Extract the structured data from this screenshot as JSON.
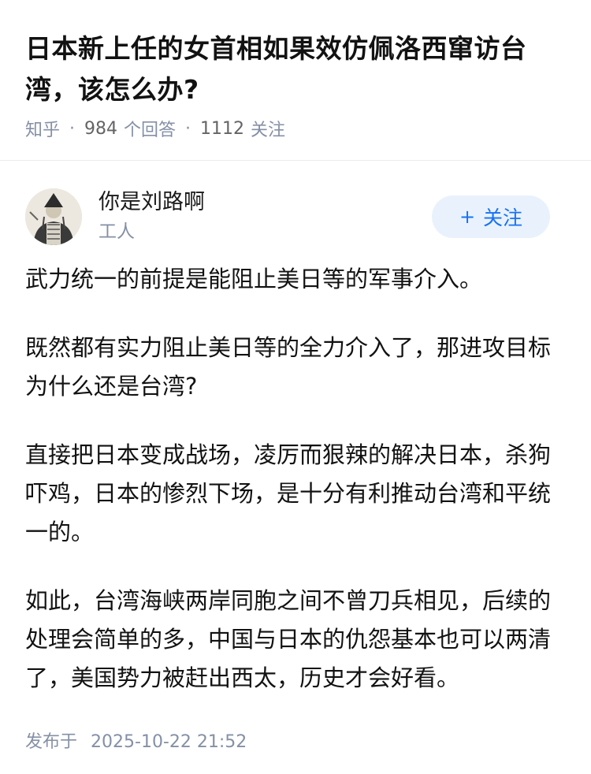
{
  "question": {
    "title": "日本新上任的女首相如果效仿佩洛西窜访台湾，该怎么办?",
    "source": "知乎",
    "answer_count": "984",
    "answer_label": "个回答",
    "follow_count": "1112",
    "follow_label": "关注"
  },
  "author": {
    "name": "你是刘路啊",
    "bio": "工人",
    "follow_button": "关注",
    "follow_icon": "+"
  },
  "answer": {
    "paragraphs": [
      "武力统一的前提是能阻止美日等的军事介入。",
      "既然都有实力阻止美日等的全力介入了，那进攻目标为什么还是台湾?",
      "直接把日本变成战场，凌厉而狠辣的解决日本，杀狗吓鸡，日本的惨烈下场，是十分有利推动台湾和平统一的。",
      "如此，台湾海峡两岸同胞之间不曾刀兵相见，后续的处理会简单的多，中国与日本的仇怨基本也可以两清了，美国势力被赶出西太，历史才会好看。"
    ],
    "published_label": "发布于",
    "published_time": "2025-10-22 21:52"
  },
  "colors": {
    "accent": "#1772f6",
    "follow_bg": "#e9f2fc",
    "meta": "#8590a6"
  }
}
